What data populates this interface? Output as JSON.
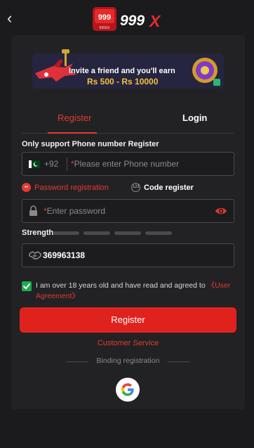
{
  "header": {
    "back_glyph": "‹",
    "logo_text_small": "999",
    "logo_text_big": "999X",
    "logo_caption": "999SX"
  },
  "banner": {
    "headline": "Invite a friend and you'll earn",
    "amount": "Rs 500 - Rs 10000"
  },
  "tabs": [
    {
      "label": "Register",
      "active": true
    },
    {
      "label": "Login",
      "active": false
    }
  ],
  "phone": {
    "label": "Only support Phone number Register",
    "country_code": "+92",
    "required_mark": "*",
    "placeholder": "Please enter Phone number"
  },
  "modes": {
    "password": "Password registration",
    "code": "Code register",
    "code_icon_text": "123"
  },
  "password": {
    "required_mark": "*",
    "placeholder": "Enter password"
  },
  "strength": {
    "label": "Strength",
    "bars": 4,
    "level": 0
  },
  "referral": {
    "value": "369963138"
  },
  "agreement": {
    "checked": true,
    "text": "I am over 18 years old and have read and agreed to",
    "link": "《User Agreement》"
  },
  "buttons": {
    "register": "Register"
  },
  "links": {
    "customer_service": "Customer Service"
  },
  "binding": {
    "label": "Binding registration"
  },
  "colors": {
    "accent": "#e33a33",
    "button": "#e0221f",
    "check": "#1faa4f",
    "background": "#1b1b1d",
    "panel": "#222224"
  },
  "icons": [
    "back-icon",
    "pakistan-flag-icon",
    "lock-icon",
    "eye-icon",
    "handshake-icon",
    "check-icon",
    "google-icon"
  ]
}
